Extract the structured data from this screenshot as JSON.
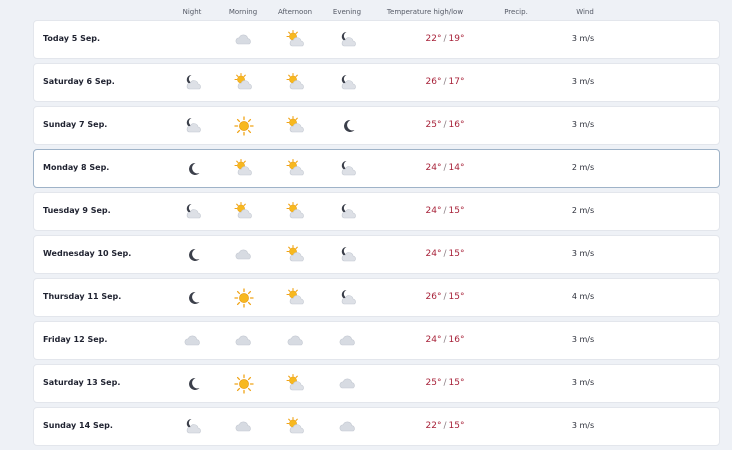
{
  "headers": {
    "night": "Night",
    "morning": "Morning",
    "afternoon": "Afternoon",
    "evening": "Evening",
    "temperature": "Temperature high/low",
    "precip": "Precip.",
    "wind": "Wind"
  },
  "rows": [
    {
      "day": "Today 5 Sep.",
      "night": "",
      "morning": "cloud",
      "afternoon": "sun-cloud",
      "evening": "moon-cloud",
      "high": "22°",
      "low": "19°",
      "wind": "3 m/s"
    },
    {
      "day": "Saturday 6 Sep.",
      "night": "moon-cloud",
      "morning": "sun-cloud",
      "afternoon": "sun-cloud",
      "evening": "moon-cloud",
      "high": "26°",
      "low": "17°",
      "wind": "3 m/s"
    },
    {
      "day": "Sunday 7 Sep.",
      "night": "moon-cloud",
      "morning": "sun",
      "afternoon": "sun-cloud",
      "evening": "moon",
      "high": "25°",
      "low": "16°",
      "wind": "3 m/s"
    },
    {
      "day": "Monday 8 Sep.",
      "night": "moon",
      "morning": "sun-cloud",
      "afternoon": "sun-cloud",
      "evening": "moon-cloud",
      "high": "24°",
      "low": "14°",
      "wind": "2 m/s"
    },
    {
      "day": "Tuesday 9 Sep.",
      "night": "moon-cloud",
      "morning": "sun-cloud",
      "afternoon": "sun-cloud",
      "evening": "moon-cloud",
      "high": "24°",
      "low": "15°",
      "wind": "2 m/s"
    },
    {
      "day": "Wednesday 10 Sep.",
      "night": "moon",
      "morning": "cloud",
      "afternoon": "sun-cloud",
      "evening": "moon-cloud",
      "high": "24°",
      "low": "15°",
      "wind": "3 m/s"
    },
    {
      "day": "Thursday 11 Sep.",
      "night": "moon",
      "morning": "sun",
      "afternoon": "sun-cloud",
      "evening": "moon-cloud",
      "high": "26°",
      "low": "15°",
      "wind": "4 m/s"
    },
    {
      "day": "Friday 12 Sep.",
      "night": "cloud",
      "morning": "cloud",
      "afternoon": "cloud",
      "evening": "cloud",
      "high": "24°",
      "low": "16°",
      "wind": "3 m/s"
    },
    {
      "day": "Saturday 13 Sep.",
      "night": "moon",
      "morning": "sun",
      "afternoon": "sun-cloud",
      "evening": "cloud",
      "high": "25°",
      "low": "15°",
      "wind": "3 m/s"
    },
    {
      "day": "Sunday 14 Sep.",
      "night": "moon-cloud",
      "morning": "cloud",
      "afternoon": "sun-cloud",
      "evening": "cloud",
      "high": "22°",
      "low": "15°",
      "wind": "3 m/s"
    }
  ],
  "colors": {
    "temperature": "#a8233a",
    "cloud": "#d4d8df",
    "sun": "#f5b21c",
    "moon": "#3b3f4a",
    "selected_border": "#9fb3c8"
  }
}
